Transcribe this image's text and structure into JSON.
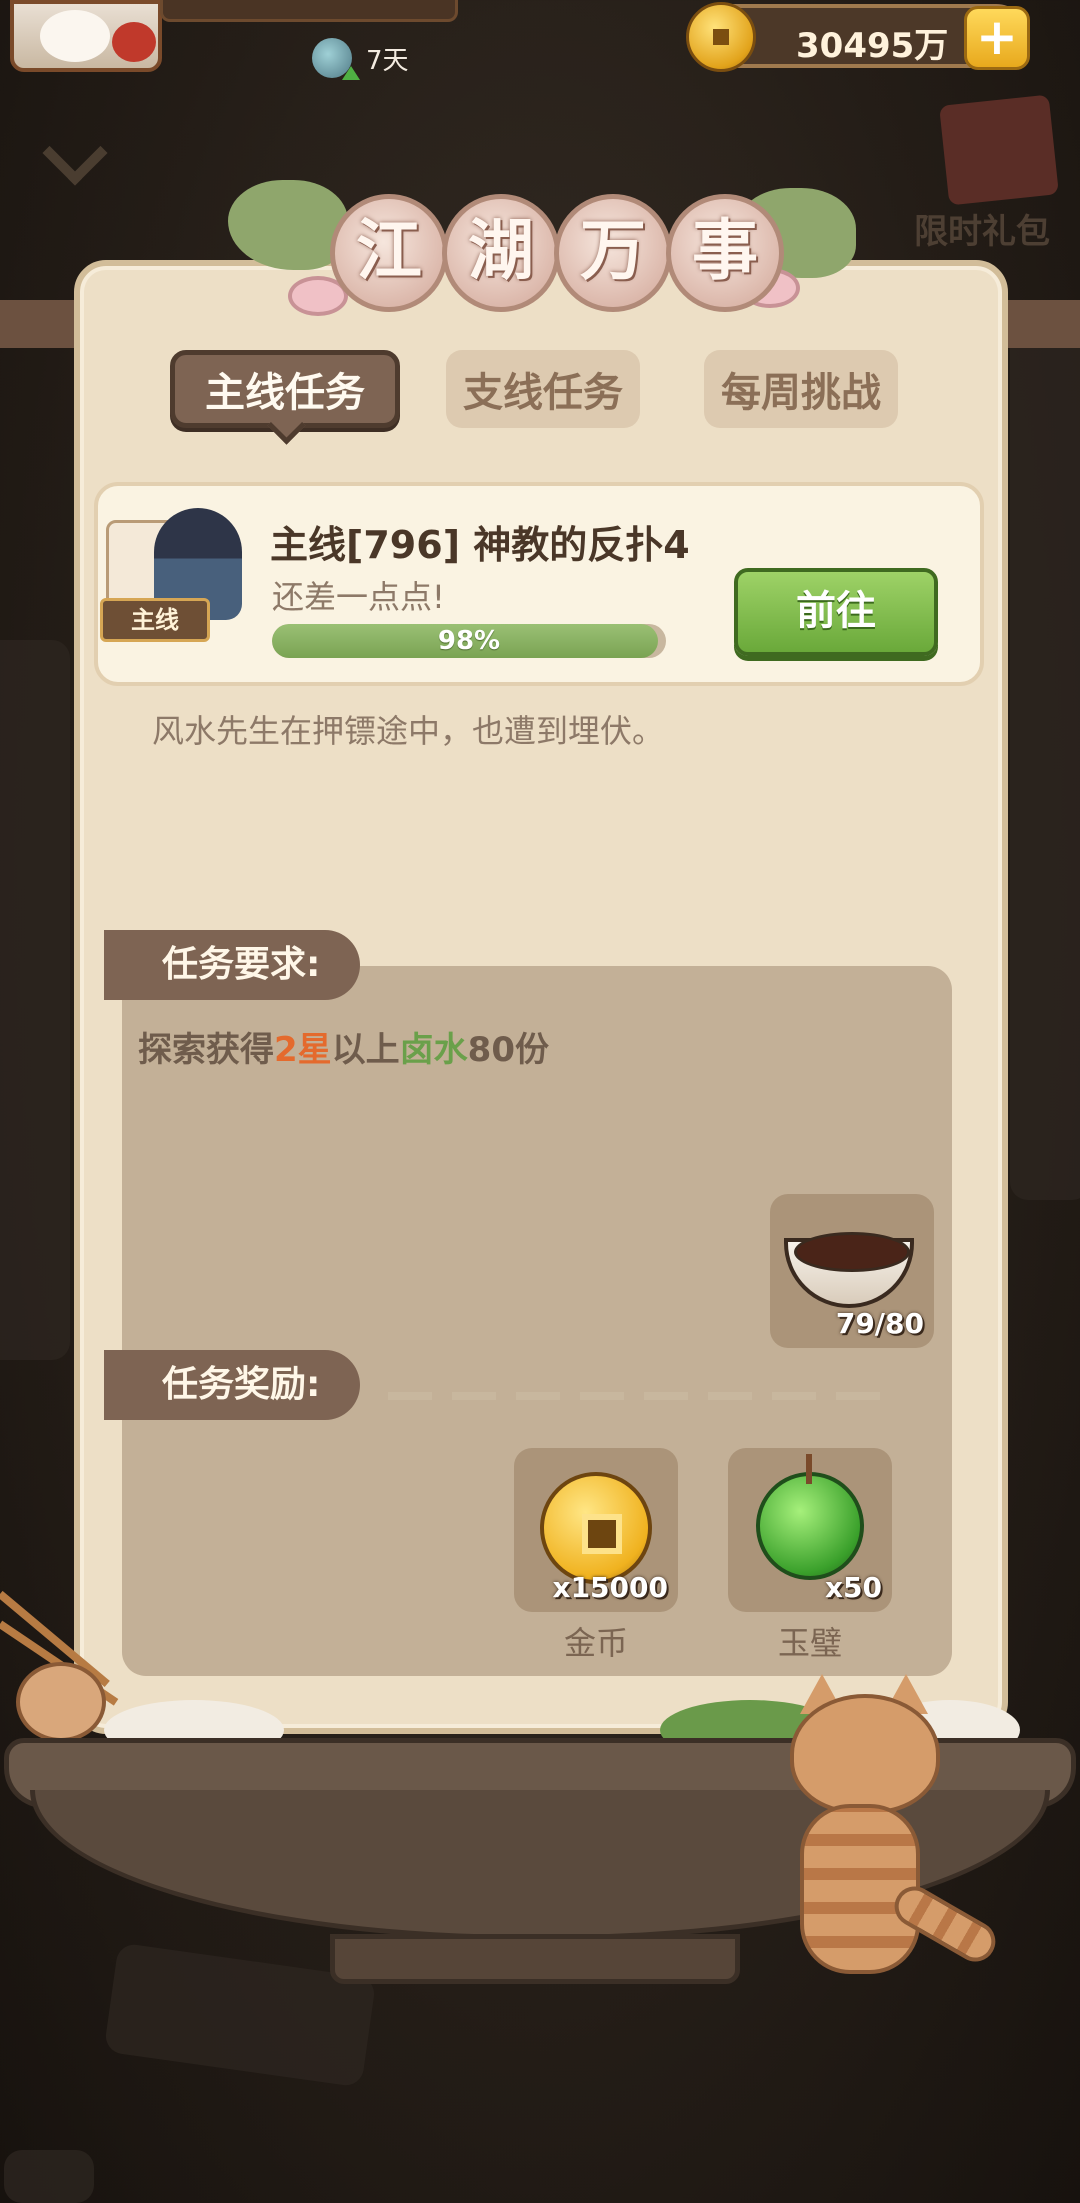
{
  "header": {
    "days": "7天",
    "coins": "30495万",
    "add_icon": "plus-icon",
    "gift_label": "限时礼包"
  },
  "panel": {
    "title_chars": [
      "江",
      "湖",
      "万",
      "事"
    ],
    "tabs": [
      {
        "label": "主线任务",
        "active": true
      },
      {
        "label": "支线任务",
        "active": false
      },
      {
        "label": "每周挑战",
        "active": false
      }
    ]
  },
  "quest": {
    "tag": "主线",
    "title": "主线[796] 神教的反扑4",
    "hint": "还差一点点!",
    "progress": 98,
    "progress_label": "98%",
    "go_button": "前往",
    "description": "风水先生在押镖途中，也遭到埋伏。"
  },
  "requirement": {
    "label": "任务要求:",
    "text_prefix": "探索获得",
    "stars": "2星",
    "text_mid": "以上",
    "item": "卤水",
    "text_suffix": "80份",
    "item_icon": "brine-bowl-icon",
    "item_count": "79/80"
  },
  "reward": {
    "label": "任务奖励:",
    "items": [
      {
        "icon": "gold-coin-icon",
        "count": "x15000",
        "name": "金币"
      },
      {
        "icon": "jade-disc-icon",
        "count": "x50",
        "name": "玉璧"
      }
    ]
  },
  "colors": {
    "accent_brown": "#7e6453",
    "button_green": "#6aa93a",
    "star_orange": "#e46a2d",
    "item_green": "#6aa04a"
  }
}
